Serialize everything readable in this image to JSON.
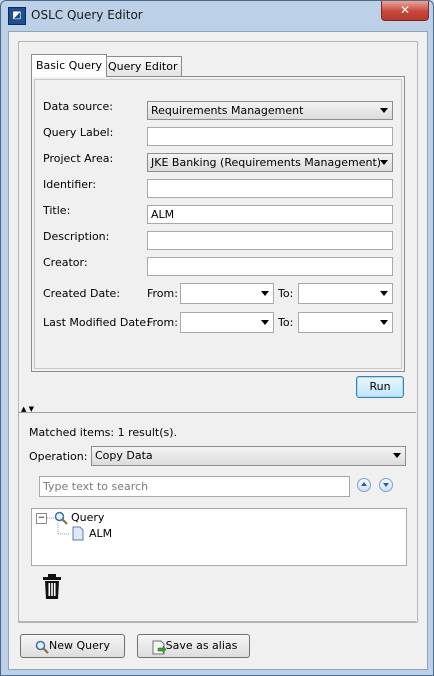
{
  "window": {
    "title": "OSLC Query Editor",
    "close_label": "✕"
  },
  "tabs": [
    {
      "label": "Basic Query"
    },
    {
      "label": "Query Editor"
    }
  ],
  "form": {
    "data_source_label": "Data source:",
    "data_source_value": "Requirements Management",
    "query_label_label": "Query Label:",
    "query_label_value": "",
    "project_area_label": "Project Area:",
    "project_area_value": "JKE Banking (Requirements Management)",
    "identifier_label": "Identifier:",
    "identifier_value": "",
    "title_label": "Title:",
    "title_value": "ALM",
    "description_label": "Description:",
    "description_value": "",
    "creator_label": "Creator:",
    "creator_value": "",
    "created_date_label": "Created Date:",
    "last_modified_date_label": "Last Modified Date:",
    "from_label": "From:",
    "to_label": "To:"
  },
  "run_button": "Run",
  "results": {
    "matched_label": "Matched items:",
    "matched_value": "1 result(s).",
    "operation_label": "Operation:",
    "operation_value": "Copy Data",
    "search_placeholder": "Type text to search"
  },
  "tree": {
    "root_label": "Query",
    "child_label": "ALM",
    "expander": "−"
  },
  "footer": {
    "new_query_label": "New Query",
    "save_alias_label": "Save as alias"
  }
}
